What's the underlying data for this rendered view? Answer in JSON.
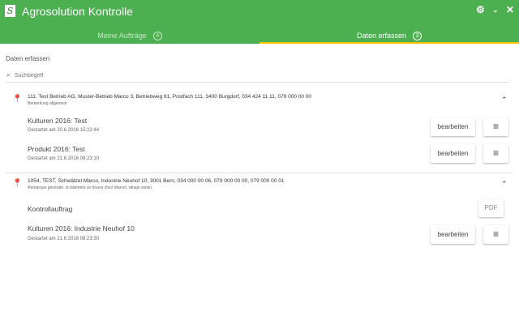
{
  "app": {
    "title": "Agrosolution Kontrolle",
    "logo": "S"
  },
  "header_icons": [
    "gear-icon",
    "chevron-down-icon",
    "close-icon"
  ],
  "tabs": [
    {
      "label": "Meine Aufträge",
      "count": "4"
    },
    {
      "label": "Daten erfassen",
      "count": "3"
    }
  ],
  "page": {
    "heading": "Daten erfassen",
    "search_placeholder": "Suchbegriff"
  },
  "groups": [
    {
      "address": "111, Test Betrieb AG, Muster-Betrieb Marco 3, Betriebweg 81, Postfach 111, 3400 Burgdorf, 034 424 11 11, 079 000 00 00",
      "remark": "Bemerkung allgemein",
      "items": [
        {
          "title": "Kulturen 2016: Test",
          "started": "Gestartet am 20.6.2016 15:22:44"
        },
        {
          "title": "Produkt 2016: Test",
          "started": "Gestartet am 21.6.2016 08:23:10"
        }
      ]
    },
    {
      "address": "1054, TEST, Schwätzel Marco, Industrie Neuhof 10, 3001 Bern, 034 000 00 06, 079 000 00 00, 079 000 00 01",
      "remark": "Remarque générale: le bâtiment se trouve chez Marcel, village voisin.",
      "kontroll": "Kontrollauftrag",
      "items": [
        {
          "title": "Kulturen 2016: Industrie Neuhof 10",
          "started": "Gestartet am 21.6.2016 08:23:30"
        }
      ]
    }
  ],
  "buttons": {
    "edit": "bearbeiten",
    "pdf": "PDF",
    "menu": "≡"
  },
  "colors": {
    "primary": "#4caf50",
    "accent": "#ffc107"
  }
}
